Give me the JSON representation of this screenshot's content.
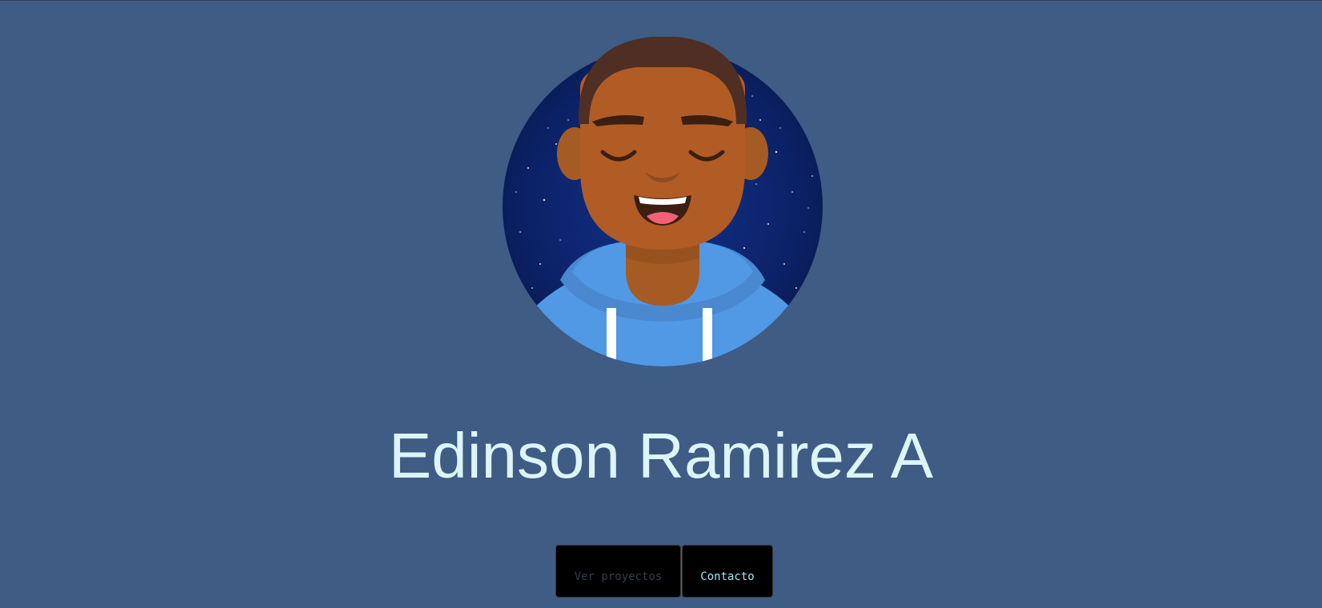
{
  "profile": {
    "name": "Edinson Ramirez A"
  },
  "actions": {
    "projects_label": "Ver proyectos",
    "contact_label": "Contacto"
  },
  "colors": {
    "background": "#3e5c84",
    "name_text": "#dcf5fb",
    "button_background": "#000000",
    "projects_text": "#2f3e4c",
    "contact_text": "#9fe6f8"
  },
  "icons": {
    "avatar": "smiling-person-avatar-icon"
  }
}
